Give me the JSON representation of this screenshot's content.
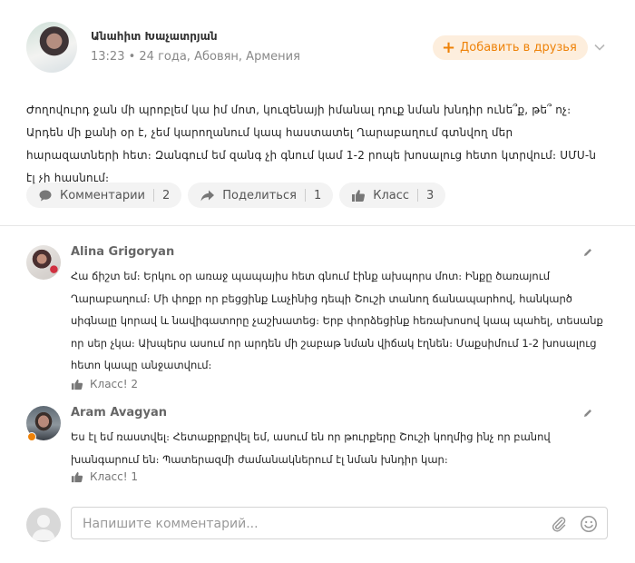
{
  "post": {
    "author_name": "Անահիտ Խաչատրյան",
    "meta": "13:23 • 24 года, Абовян, Армения",
    "add_friend_label": "Добавить в друзья",
    "text": "Ժողովուրդ ջան մի պրոբլեմ կա իմ մոտ, կուզենայի իմանալ դուք նման խնդիր ունե՞ք, թե՞ ոչ։ Արդեն մի քանի օր է, չեմ կարողանում կապ հաստատել Ղարաբաղում գտնվող մեր հարազատների հետ։ Զանգում եմ զանգ չի գնում կամ 1-2 րոպե խոսալուց հետո կտրվում։ ՍՄՍ-ն էլ չի հասնում։",
    "actions": {
      "comments": {
        "label": "Комментарии",
        "count": "2"
      },
      "share": {
        "label": "Поделиться",
        "count": "1"
      },
      "like": {
        "label": "Класс",
        "count": "3"
      }
    }
  },
  "comments": [
    {
      "name": "Alina Grigoryan",
      "text": "Հա ճիշտ եմ։ Երկու օր առաջ պապայիս հետ գնում էինք ախպորս մոտ։ Ինքը ծառայում Ղարաբաղում։ Մի փոքր որ բեցցինք Լաչինից դեպի Շուշի տանող ճանապարհով, հանկարծ սիգնալը կորավ և նավիգատորը չաշխատեց։ Երբ փորձեցինք հեռախոսով կապ պահել, տեսանք որ սեր չկա։ Ախպերս ասում որ արդեն մի շաբաթ նման վիճակ էղնեն։ Մաքսիմում 1-2 խոսալուց հետո կապը անջատվում։",
      "likes": "Класс! 2"
    },
    {
      "name": "Aram Avagyan",
      "text": "Ես էլ եմ ռաստվել։ Հետաքրքրվել եմ, ասում են որ թուրքերը Շուշի կողմից ինչ որ բանով խանգարում են։ Պատերազմի ժամանակներում էլ նման խնդիր կար։",
      "likes": "Класс! 1"
    }
  ],
  "composer": {
    "placeholder": "Напишите комментарий..."
  },
  "colors": {
    "accent_orange": "#ee8208",
    "pill_bg": "#f3f3f3",
    "add_friend_bg": "#fdeedd"
  }
}
